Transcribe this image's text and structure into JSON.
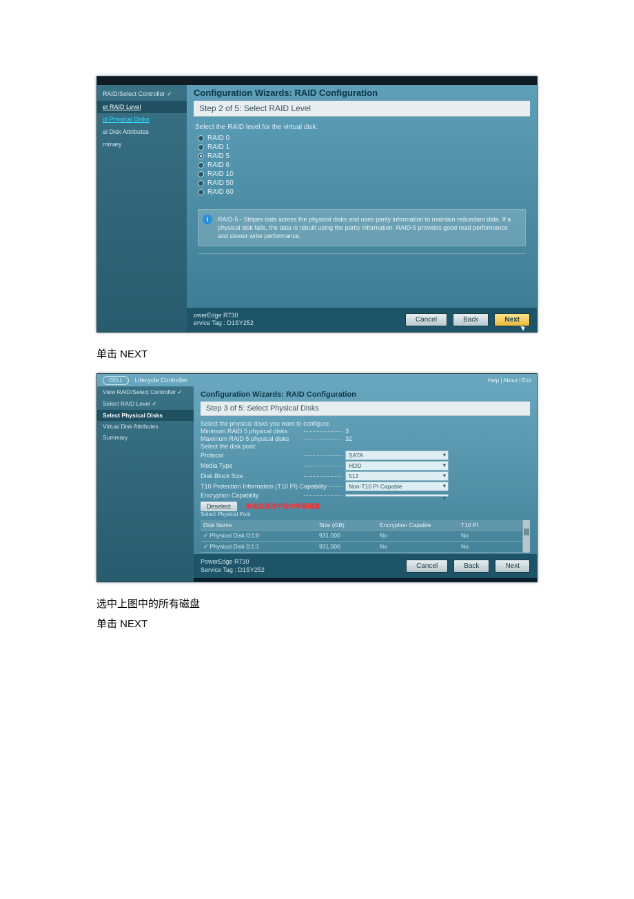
{
  "caption1": "单击 NEXT",
  "caption2a": "选中上图中的所有磁盘",
  "caption2b": "单击 NEXT",
  "ss1": {
    "sidebar": {
      "items": [
        "RAID/Select Controller",
        "et RAID Level",
        "ct Physical Disks",
        "al Disk Attributes",
        "mmary"
      ]
    },
    "title": "Configuration Wizards: RAID Configuration",
    "step": "Step 2 of 5: Select RAID Level",
    "label": "Select the RAID level for the virtual disk:",
    "radios": [
      "RAID 0",
      "RAID 1",
      "RAID 5",
      "RAID 6",
      "RAID 10",
      "RAID 50",
      "RAID 60"
    ],
    "selected_radio": "RAID 5",
    "info": "RAID-5 - Stripes data across the physical disks and uses parity information to maintain redundant data. If a physical disk fails, the data is rebuilt using the parity information. RAID-5 provides good read performance and slower write performance.",
    "foot_model": "owerEdge R730",
    "foot_tag": "ervice Tag : D1SY252",
    "buttons": {
      "cancel": "Cancel",
      "back": "Back",
      "next": "Next"
    }
  },
  "ss2": {
    "header_app": "Lifecycle Controller",
    "header_links": "Help | About | Exit",
    "logo_text": "DELL",
    "sidebar": {
      "items": [
        "View RAID/Select Controller",
        "Select RAID Level",
        "Select Physical Disks",
        "Virtual Disk Attributes",
        "Summary"
      ]
    },
    "title": "Configuration Wizards: RAID Configuration",
    "step": "Step 3 of 5: Select Physical Disks",
    "label_intro": "Select the physical disks you want to configure.",
    "kv": {
      "min_label": "Minimum RAID 5 physical disks",
      "min_value": "3",
      "max_label": "Maximum RAID 5 physical disks",
      "max_value": "32",
      "pool_label": "Select the disk pool:",
      "proto_label": "Protocol",
      "proto_value": "SATA",
      "media_label": "Media Type",
      "media_value": "HDD",
      "block_label": "Disk Block Size",
      "block_value": "512",
      "t10_label": "T10 Protection Information (T10 PI) Capability",
      "t10_value": "Non-T10 PI Capable",
      "enc_label": "Encryption Capability",
      "enc_value": ""
    },
    "deselect": "Deselect",
    "annotation": "单击此处选中选中所有磁盘",
    "select_pool": "Select Physical Pool",
    "table": {
      "headers": [
        "Disk Name",
        "Size (GB)",
        "Encryption Capable",
        "T10 PI"
      ],
      "rows": [
        [
          "✓ Physical Disk 0:1:0",
          "931.000",
          "No",
          "No"
        ],
        [
          "✓ Physical Disk 0:1:1",
          "931.000",
          "No",
          "No"
        ]
      ]
    },
    "foot_model": "PowerEdge R730",
    "foot_tag": "Service Tag : D1SY252",
    "buttons": {
      "cancel": "Cancel",
      "back": "Back",
      "next": "Next"
    }
  }
}
